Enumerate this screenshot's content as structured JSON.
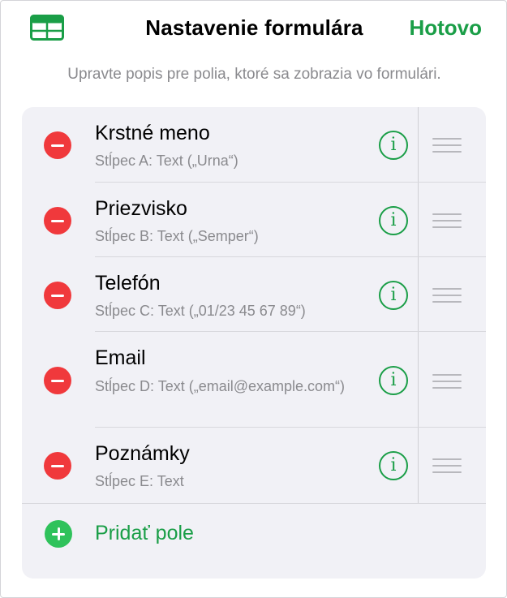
{
  "header": {
    "title": "Nastavenie formulára",
    "done_label": "Hotovo",
    "icon": "table-icon"
  },
  "subtitle": "Upravte popis pre polia, ktoré sa zobrazia vo formulári.",
  "fields": [
    {
      "label": "Krstné meno",
      "detail": "Stĺpec A: Text („Urna“)"
    },
    {
      "label": "Priezvisko",
      "detail": "Stĺpec B: Text („Semper“)"
    },
    {
      "label": "Telefón",
      "detail": "Stĺpec C: Text („01/23 45 67 89“)"
    },
    {
      "label": "Email",
      "detail": "Stĺpec D: Text („email@example.com“)"
    },
    {
      "label": "Poznámky",
      "detail": "Stĺpec E: Text"
    }
  ],
  "add_field_label": "Pridať pole",
  "colors": {
    "accent": "#1a9e47",
    "delete": "#f0393c",
    "add": "#2fc25b",
    "card_bg": "#f1f1f6"
  }
}
